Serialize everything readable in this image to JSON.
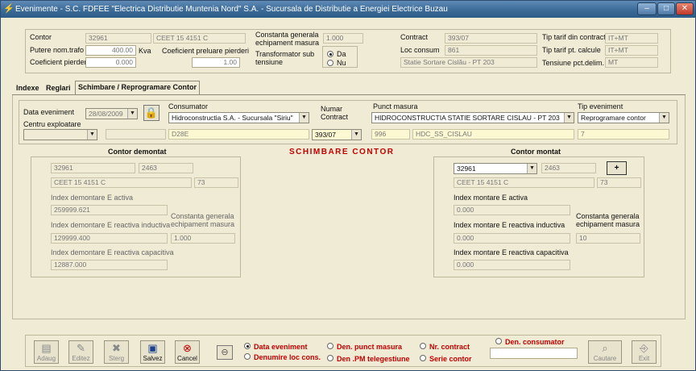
{
  "window": {
    "title": "Evenimente - S.C. FDFEE \"Electrica Distributie Muntenia Nord\" S.A. - Sucursala de Distributie a Energiei Electrice Buzau",
    "minimize_glyph": "–",
    "maximize_glyph": "□",
    "close_glyph": "✕"
  },
  "header": {
    "contor_label": "Contor",
    "contor_value": "32961",
    "contor_serie": "CEET 15 4151 C",
    "putere_label": "Putere nom.trafo",
    "putere_value": "400.00",
    "putere_unit": "Kva",
    "coef_pierderi_label": "Coeficient pierderi",
    "coef_pierderi_value": "0.000",
    "coef_preluare_label": "Coeficient preluare pierderi",
    "coef_preluare_value": "1.00",
    "constanta_label": "Constanta generala echipament masura",
    "constanta_value": "1.000",
    "transformator_label": "Transformator sub tensiune",
    "da_label": "Da",
    "nu_label": "Nu",
    "contract_label": "Contract",
    "contract_value": "393/07",
    "loc_consum_label": "Loc consum",
    "loc_consum_value": "861",
    "loc_consum_name": "Statie Sortare Cislău - PT 203",
    "tip_tarif_contract_label": "Tip tarif din contract",
    "tip_tarif_contract_value": "IT+MT",
    "tip_tarif_calcule_label": "Tip tarif pt. calcule",
    "tip_tarif_calcule_value": "IT+MT",
    "tensiune_label": "Tensiune pct.delim.",
    "tensiune_value": "MT"
  },
  "tabs": [
    {
      "label": "Indexe"
    },
    {
      "label": "Reglari"
    },
    {
      "label": "Schimbare / Reprogramare Contor"
    }
  ],
  "event": {
    "data_eveniment_label": "Data eveniment",
    "data_eveniment_value": "28/08/2009",
    "centru_label": "Centru exploatare",
    "centru_value": "",
    "consumator_label": "Consumator",
    "consumator_value": "Hidroconstructia S.A. - Sucursala \"Siriu\"",
    "consumator_code": "D28E",
    "numar_contract_label": "Numar Contract",
    "numar_contract_value": "393/07",
    "punct_masura_label": "Punct masura",
    "punct_masura_value": "HIDROCONSTRUCTIA STATIE SORTARE CISLAU - PT 203",
    "punct_code": "996",
    "punct_name": "HDC_SS_CISLAU",
    "tip_eveniment_label": "Tip eveniment",
    "tip_eveniment_value": "Reprogramare contor",
    "tip_code": "7"
  },
  "schimbare_label": "SCHIMBARE CONTOR",
  "demontat": {
    "title": "Contor demontat",
    "nr": "32961",
    "cod": "2463",
    "serie": "CEET 15 4151 C",
    "fab": "73",
    "idx_activa_label": "Index demontare E activa",
    "idx_activa_value": "259999.621",
    "idx_inductiva_label": "Index demontare E reactiva inductiva",
    "idx_inductiva_value": "129999.400",
    "constanta_label": "Constanta generala echipament masura",
    "constanta_value": "1.000",
    "idx_capacitiva_label": "Index demontare E reactiva capacitiva",
    "idx_capacitiva_value": "12887.000"
  },
  "montat": {
    "title": "Contor montat",
    "nr": "32961",
    "cod": "2463",
    "add_label": "+",
    "serie": "CEET 15 4151 C",
    "fab": "73",
    "idx_activa_label": "Index montare E activa",
    "idx_activa_value": "0.000",
    "idx_inductiva_label": "Index montare E reactiva inductiva",
    "idx_inductiva_value": "0.000",
    "constanta_label": "Constanta generala echipament masura",
    "constanta_value": "10",
    "idx_capacitiva_label": "Index montare E reactiva capacitiva",
    "idx_capacitiva_value": "0.000"
  },
  "toolbar": {
    "adaug": "Adaug",
    "editez": "Editez",
    "sterg": "Sterg",
    "salvez": "Salvez",
    "cancel": "Cancel",
    "cautare": "Cautare",
    "exit": "Exit",
    "search_value": ""
  },
  "search_options": {
    "data_eveniment": "Data eveniment",
    "denumire_loc": "Denumire loc cons.",
    "den_punct": "Den. punct masura",
    "den_pm_tele": "Den .PM telegestiune",
    "nr_contract": "Nr. contract",
    "serie_contor": "Serie contor",
    "den_consumator": "Den. consumator"
  },
  "colors": {
    "accent_red": "#c20000",
    "window_bg": "#efebd4",
    "highlight_yellow": "#fcf9d2"
  }
}
